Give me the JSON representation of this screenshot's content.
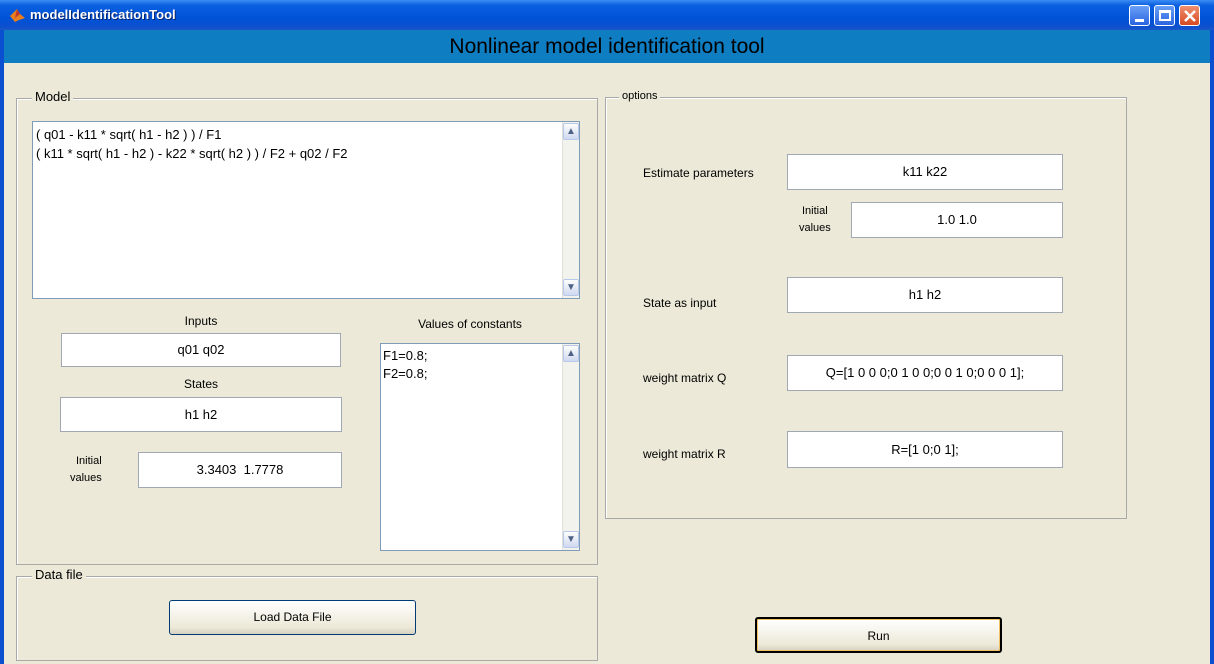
{
  "window": {
    "title": "modelIdentificationTool",
    "minimize_icon": "minimize-icon",
    "maximize_icon": "maximize-icon",
    "close_icon": "close-icon",
    "app_icon": "matlab-logo-icon"
  },
  "header": {
    "title": "Nonlinear model identification tool",
    "color": "#0f7dc2"
  },
  "model": {
    "panel_title": "Model",
    "equations": [
      "( q01 - k11 * sqrt( h1 - h2 ) ) / F1",
      "( k11 * sqrt( h1 - h2 ) - k22 * sqrt( h2 ) ) / F2 + q02 / F2"
    ],
    "inputs_label": "Inputs",
    "inputs_value": "q01 q02",
    "states_label": "States",
    "states_value": "h1 h2",
    "initial_label_1": "Initial",
    "initial_label_2": "values",
    "initial_value": "3.3403  1.7778",
    "constants_label": "Values of constants",
    "constants": [
      "F1=0.8;",
      "F2=0.8;"
    ]
  },
  "datafile": {
    "panel_title": "Data file",
    "load_button": "Load Data File"
  },
  "options": {
    "panel_title": "options",
    "estimate_label": "Estimate parameters",
    "estimate_value": "k11 k22",
    "initial_label_1": "Initial",
    "initial_label_2": "values",
    "initial_value": "1.0 1.0",
    "state_input_label": "State as input",
    "state_input_value": "h1 h2",
    "q_label": "weight matrix Q",
    "q_value": "Q=[1 0 0 0;0 1 0 0;0 0 1 0;0 0 0 1];",
    "r_label": "weight matrix R",
    "r_value": "R=[1 0;0 1];"
  },
  "run_button": "Run"
}
